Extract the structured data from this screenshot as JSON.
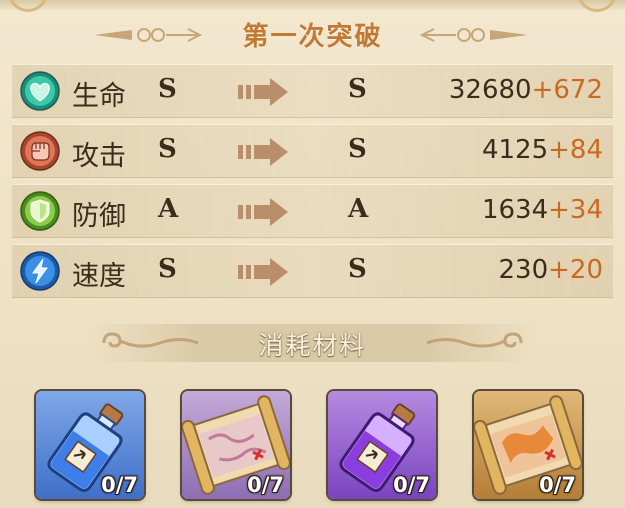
{
  "header": {
    "title": "第一次突破"
  },
  "stats": [
    {
      "name": "生命",
      "icon": "heart-icon",
      "from": "S",
      "to": "S",
      "value": "32680",
      "bonus": "+672",
      "color": "#2fb79a"
    },
    {
      "name": "攻击",
      "icon": "fist-icon",
      "from": "S",
      "to": "S",
      "value": "4125",
      "bonus": "+84",
      "color": "#d86a4a"
    },
    {
      "name": "防御",
      "icon": "shield-icon",
      "from": "A",
      "to": "A",
      "value": "1634",
      "bonus": "+34",
      "color": "#7cb83a"
    },
    {
      "name": "速度",
      "icon": "lightning-icon",
      "from": "S",
      "to": "S",
      "value": "230",
      "bonus": "+20",
      "color": "#2e7fd6"
    }
  ],
  "materials": {
    "title": "消耗材料",
    "items": [
      {
        "icon": "blue-potion-bottle-icon",
        "count": "0/7",
        "color": "#5a8ad8"
      },
      {
        "icon": "purple-map-scroll-icon",
        "count": "0/7",
        "color": "#9a7ab8"
      },
      {
        "icon": "purple-potion-bottle-icon",
        "count": "0/7",
        "color": "#8a4ac8"
      },
      {
        "icon": "orange-map-scroll-icon",
        "count": "0/7",
        "color": "#c88a3a"
      }
    ]
  }
}
